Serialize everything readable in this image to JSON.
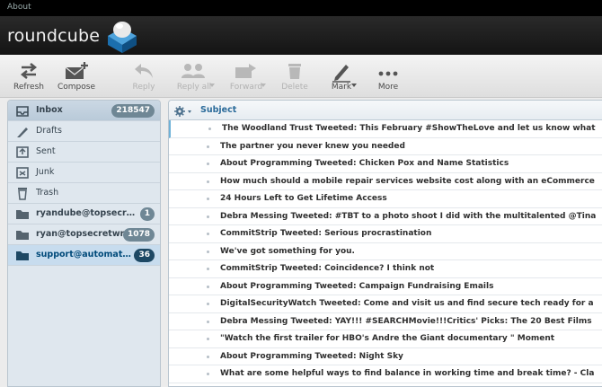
{
  "topbar": {
    "about_label": "About"
  },
  "brand": {
    "name": "roundcube",
    "logo_icon": "roundcube-cube-logo-icon"
  },
  "toolbar": {
    "buttons": [
      {
        "label": "Refresh",
        "icon": "refresh-icon",
        "enabled": true
      },
      {
        "label": "Compose",
        "icon": "compose-icon",
        "enabled": true
      },
      {
        "label": "Reply",
        "icon": "reply-icon",
        "enabled": false
      },
      {
        "label": "Reply all",
        "icon": "reply-all-icon",
        "enabled": false
      },
      {
        "label": "Forward",
        "icon": "forward-icon",
        "enabled": false
      },
      {
        "label": "Delete",
        "icon": "trash-icon",
        "enabled": false
      },
      {
        "label": "Mark",
        "icon": "mark-pen-icon",
        "enabled": true
      },
      {
        "label": "More",
        "icon": "more-dots-icon",
        "enabled": true
      }
    ]
  },
  "folders": [
    {
      "name": "Inbox",
      "icon": "inbox-icon",
      "count": "218547",
      "bold": true
    },
    {
      "name": "Drafts",
      "icon": "pencil-icon",
      "count": ""
    },
    {
      "name": "Sent",
      "icon": "sent-icon",
      "count": ""
    },
    {
      "name": "Junk",
      "icon": "junk-icon",
      "count": ""
    },
    {
      "name": "Trash",
      "icon": "trash-icon",
      "count": ""
    },
    {
      "name": "ryandube@topsecr…",
      "icon": "folder-icon",
      "count": "1",
      "bold": true
    },
    {
      "name": "ryan@topsecretwr…",
      "icon": "folder-icon",
      "count": "1078",
      "bold": true
    },
    {
      "name": "support@automat…",
      "icon": "folder-icon",
      "count": "36",
      "bold": true,
      "selected": true
    }
  ],
  "message_list": {
    "column_subject": "Subject",
    "options_icon": "gear-icon",
    "messages": [
      "The Woodland Trust Tweeted: This February #ShowTheLove and let us know what",
      "The partner you never knew you needed",
      "About Programming Tweeted: Chicken Pox and Name Statistics",
      "How much should a mobile repair services website cost along with an eCommerce",
      "24 Hours Left to Get Lifetime Access",
      "Debra Messing Tweeted: #TBT to a photo shoot I did with the multitalented @Tina",
      "CommitStrip Tweeted: Serious procrastination",
      "We've got something for you.",
      "CommitStrip Tweeted: Coincidence? I think not",
      "About Programming Tweeted: Campaign Fundraising Emails",
      "DigitalSecurityWatch Tweeted: Come and visit us and find secure tech ready for a",
      "Debra Messing Tweeted: YAY!!! #SEARCHMovie!!!Critics' Picks: The 20 Best Films",
      "\"Watch the first trailer for HBO's Andre the Giant documentary \" Moment",
      "About Programming Tweeted: Night Sky",
      "What are some helpful ways to find balance in working time and break time? - Cla"
    ]
  },
  "colors": {
    "accent": "#2b6b9a",
    "selected_folder": "#c7dcee",
    "badge_dark": "#1d4864"
  }
}
